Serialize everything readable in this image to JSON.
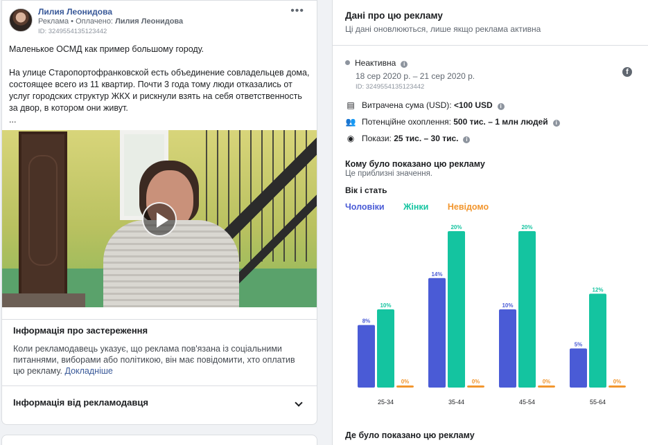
{
  "post": {
    "author": "Лилия Леонидова",
    "meta_prefix": "Реклама • Оплачено: ",
    "meta_payer": "Лилия Леонидова",
    "id": "ID: 3249554135123442",
    "more_icon": "more-horizontal-icon",
    "text": [
      "Маленькое ОСМД как пример большому городу.",
      "На улице Старопортофранковской есть объединение совладельцев дома, состоящее всего из 11 квартир. Почти 3 года тому люди отказались от услуг городских структур ЖКХ и рискнули взять на себя ответственность за двор, в котором они живут.",
      "..."
    ]
  },
  "disclaimer": {
    "title": "Інформація про застереження",
    "body": "Коли рекламодавець указує, що реклама пов'язана із соціальними питаннями, виборами або політикою, він має повідомити, хто оплатив цю рекламу.",
    "link": "Докладніше"
  },
  "advertiser": {
    "title": "Інформація від рекламодавця"
  },
  "ad_data": {
    "title": "Дані про цю рекламу",
    "subtitle": "Ці дані оновлюються, лише якщо реклама активна",
    "status": "Неактивна",
    "dates": "18 сер 2020 р. – 21 сер 2020 р.",
    "id": "ID: 3249554135123442",
    "spent_label": "Витрачена сума (USD): ",
    "spent_value": "<100 USD",
    "reach_label": "Потенційне охоплення: ",
    "reach_value": "500 тис. – 1 млн людей",
    "impr_label": "Покази: ",
    "impr_value": "25 тис. – 30 тис."
  },
  "audience": {
    "title": "Кому було показано цю рекламу",
    "subtitle": "Це приблизні значення.",
    "age_title": "Вік і стать",
    "legend_men": "Чоловіки",
    "legend_women": "Жінки",
    "legend_unknown": "Невідомо"
  },
  "where_title": "Де було показано цю рекламу",
  "colors": {
    "men": "#4a5bd6",
    "women": "#14c4a0",
    "unknown": "#f2962e",
    "link": "#385898"
  },
  "chart_data": {
    "type": "bar",
    "categories": [
      "25-34",
      "35-44",
      "45-54",
      "55-64"
    ],
    "series": [
      {
        "name": "Чоловіки",
        "values": [
          8,
          14,
          10,
          5
        ]
      },
      {
        "name": "Жінки",
        "values": [
          10,
          20,
          20,
          12
        ]
      },
      {
        "name": "Невідомо",
        "values": [
          0,
          0,
          0,
          0
        ]
      }
    ],
    "labels": [
      [
        "8%",
        "10%",
        "0%"
      ],
      [
        "14%",
        "20%",
        "0%"
      ],
      [
        "10%",
        "20%",
        "0%"
      ],
      [
        "5%",
        "12%",
        "0%"
      ]
    ],
    "ylim": [
      0,
      20
    ],
    "title": "Вік і стать"
  }
}
